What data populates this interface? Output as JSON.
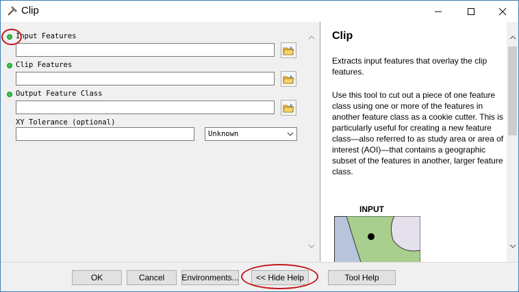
{
  "window": {
    "title": "Clip",
    "icon": "hammer-icon"
  },
  "titlebar_buttons": [
    "minimize-icon",
    "maximize-icon",
    "close-icon"
  ],
  "params": {
    "input_features": {
      "label": "Input Features",
      "value": "",
      "required": true
    },
    "clip_features": {
      "label": "Clip Features",
      "value": "",
      "required": true
    },
    "output_feature_class": {
      "label": "Output Feature Class",
      "value": "",
      "required": true
    },
    "xy_tolerance": {
      "label": "XY Tolerance (optional)",
      "value": "",
      "unit": "Unknown"
    }
  },
  "help": {
    "title": "Clip",
    "para1": "Extracts input features that overlay the clip features.",
    "para2": "Use this tool to cut out a piece of one feature class using one or more of the features in another feature class as a cookie cutter. This is particularly useful for creating a new feature class—also referred to as study area or area of interest (AOI)—that contains a geographic subset of the features in another, larger feature class.",
    "image_label": "INPUT"
  },
  "buttons": {
    "ok": "OK",
    "cancel": "Cancel",
    "environments": "Environments...",
    "hide_help": "<< Hide Help",
    "tool_help": "Tool Help"
  },
  "colors": {
    "required_dot": "#2ecc40",
    "annotation": "#c0161c",
    "window_border": "#3c7fb1"
  }
}
